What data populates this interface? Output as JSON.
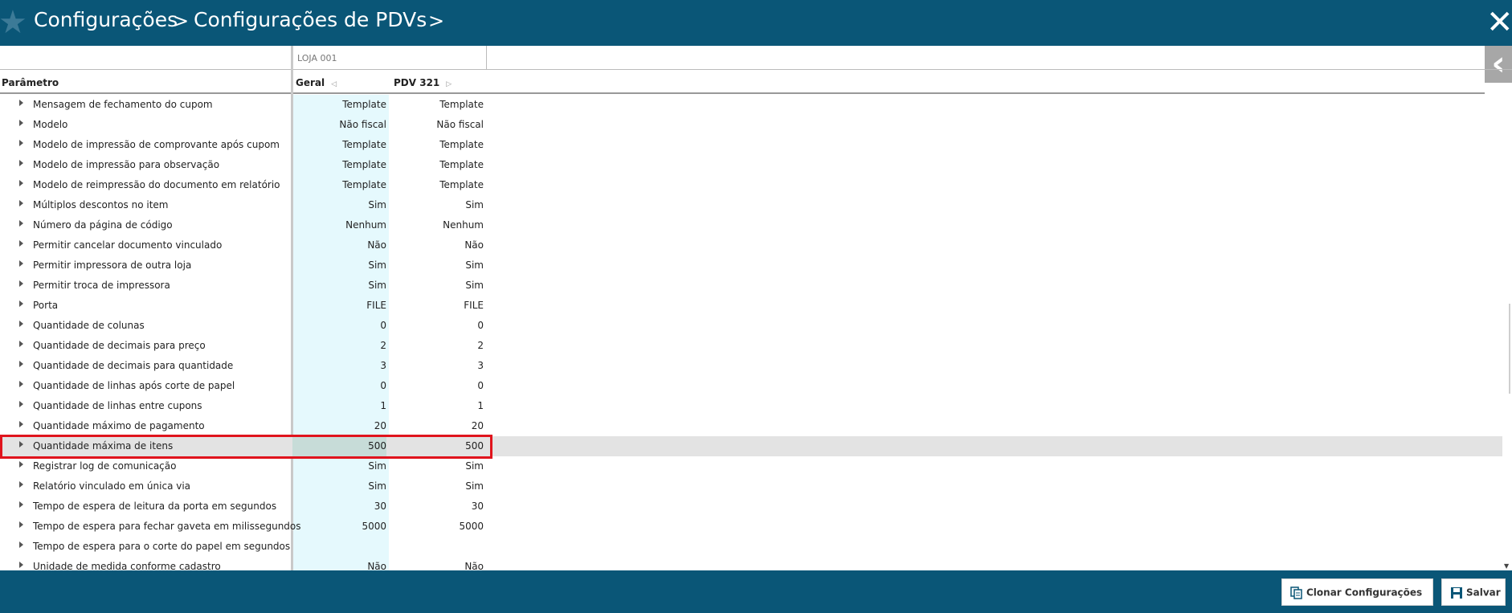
{
  "header": {
    "breadcrumb": [
      "Configurações",
      "Configurações de PDVs"
    ],
    "separator": ">",
    "close_label": "✕"
  },
  "grid": {
    "store_label": "LOJA 001",
    "columns": {
      "parameter": "Parâmetro",
      "general": "Geral",
      "pdv": "PDV 321"
    },
    "rows": [
      {
        "label": "Mensagem de fechamento do cupom",
        "geral": "Template",
        "pdv": "Template"
      },
      {
        "label": "Modelo",
        "geral": "Não fiscal",
        "pdv": "Não fiscal"
      },
      {
        "label": "Modelo de impressão de comprovante após cupom",
        "geral": "Template",
        "pdv": "Template"
      },
      {
        "label": "Modelo de impressão para observação",
        "geral": "Template",
        "pdv": "Template"
      },
      {
        "label": "Modelo de reimpressão do documento em relatório",
        "geral": "Template",
        "pdv": "Template"
      },
      {
        "label": "Múltiplos descontos no item",
        "geral": "Sim",
        "pdv": "Sim"
      },
      {
        "label": "Número da página de código",
        "geral": "Nenhum",
        "pdv": "Nenhum"
      },
      {
        "label": "Permitir cancelar documento vinculado",
        "geral": "Não",
        "pdv": "Não"
      },
      {
        "label": "Permitir impressora de outra loja",
        "geral": "Sim",
        "pdv": "Sim"
      },
      {
        "label": "Permitir troca de impressora",
        "geral": "Sim",
        "pdv": "Sim"
      },
      {
        "label": "Porta",
        "geral": "FILE",
        "pdv": "FILE"
      },
      {
        "label": "Quantidade de colunas",
        "geral": "0",
        "pdv": "0"
      },
      {
        "label": "Quantidade de decimais para preço",
        "geral": "2",
        "pdv": "2"
      },
      {
        "label": "Quantidade de decimais para quantidade",
        "geral": "3",
        "pdv": "3"
      },
      {
        "label": "Quantidade de linhas após corte de papel",
        "geral": "0",
        "pdv": "0"
      },
      {
        "label": "Quantidade de linhas entre cupons",
        "geral": "1",
        "pdv": "1"
      },
      {
        "label": "Quantidade máximo de pagamento",
        "geral": "20",
        "pdv": "20"
      },
      {
        "label": "Quantidade máxima de itens",
        "geral": "500",
        "pdv": "500"
      },
      {
        "label": "Registrar log de comunicação",
        "geral": "Sim",
        "pdv": "Sim"
      },
      {
        "label": "Relatório vinculado em única via",
        "geral": "Sim",
        "pdv": "Sim"
      },
      {
        "label": "Tempo de espera de leitura da porta em segundos",
        "geral": "30",
        "pdv": "30"
      },
      {
        "label": "Tempo de espera para fechar gaveta em milissegundos",
        "geral": "5000",
        "pdv": "5000"
      },
      {
        "label": "Tempo de espera para o corte do papel em segundos",
        "geral": "",
        "pdv": ""
      },
      {
        "label": "Unidade de medida conforme cadastro",
        "geral": "Não",
        "pdv": "Não"
      }
    ],
    "selected_row": "Quantidade máxima de itens"
  },
  "footer": {
    "clone_label": "Clonar Configurações",
    "save_label": "Salvar"
  },
  "colors": {
    "brand": "#0a5677",
    "geral_column_bg": "#e5f9fd",
    "highlight_border": "#e0141d",
    "selected_row_bg": "#e3e3e3"
  }
}
